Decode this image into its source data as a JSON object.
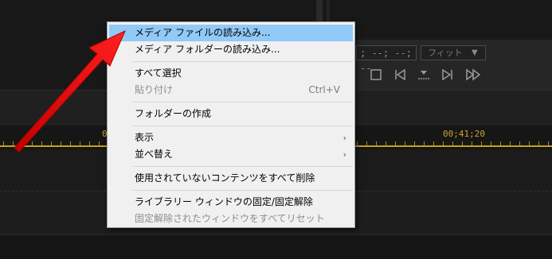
{
  "preview": {
    "timecode": "; --; --; --",
    "fit_label": "フィット",
    "fit_arrow": "▼"
  },
  "timeline": {
    "tc_left": "0",
    "tc_right": "00;41;20"
  },
  "context_menu": {
    "items": [
      {
        "label": "メディア ファイルの読み込み...",
        "state": "highlighted"
      },
      {
        "label": "メディア フォルダーの読み込み..."
      },
      {
        "label": "すべて選択"
      },
      {
        "label": "貼り付け",
        "shortcut": "Ctrl+V",
        "state": "disabled"
      },
      {
        "label": "フォルダーの作成"
      },
      {
        "label": "表示",
        "submenu": "›"
      },
      {
        "label": "並べ替え",
        "submenu": "›"
      },
      {
        "label": "使用されていないコンテンツをすべて削除"
      },
      {
        "label": "ライブラリー ウィンドウの固定/固定解除"
      },
      {
        "label": "固定解除されたウィンドウをすべてリセット",
        "state": "disabled"
      }
    ]
  },
  "colors": {
    "accent_arrow": "#ff1a1a",
    "highlight": "#91c9f7",
    "timeline_gold": "#c8a531"
  }
}
